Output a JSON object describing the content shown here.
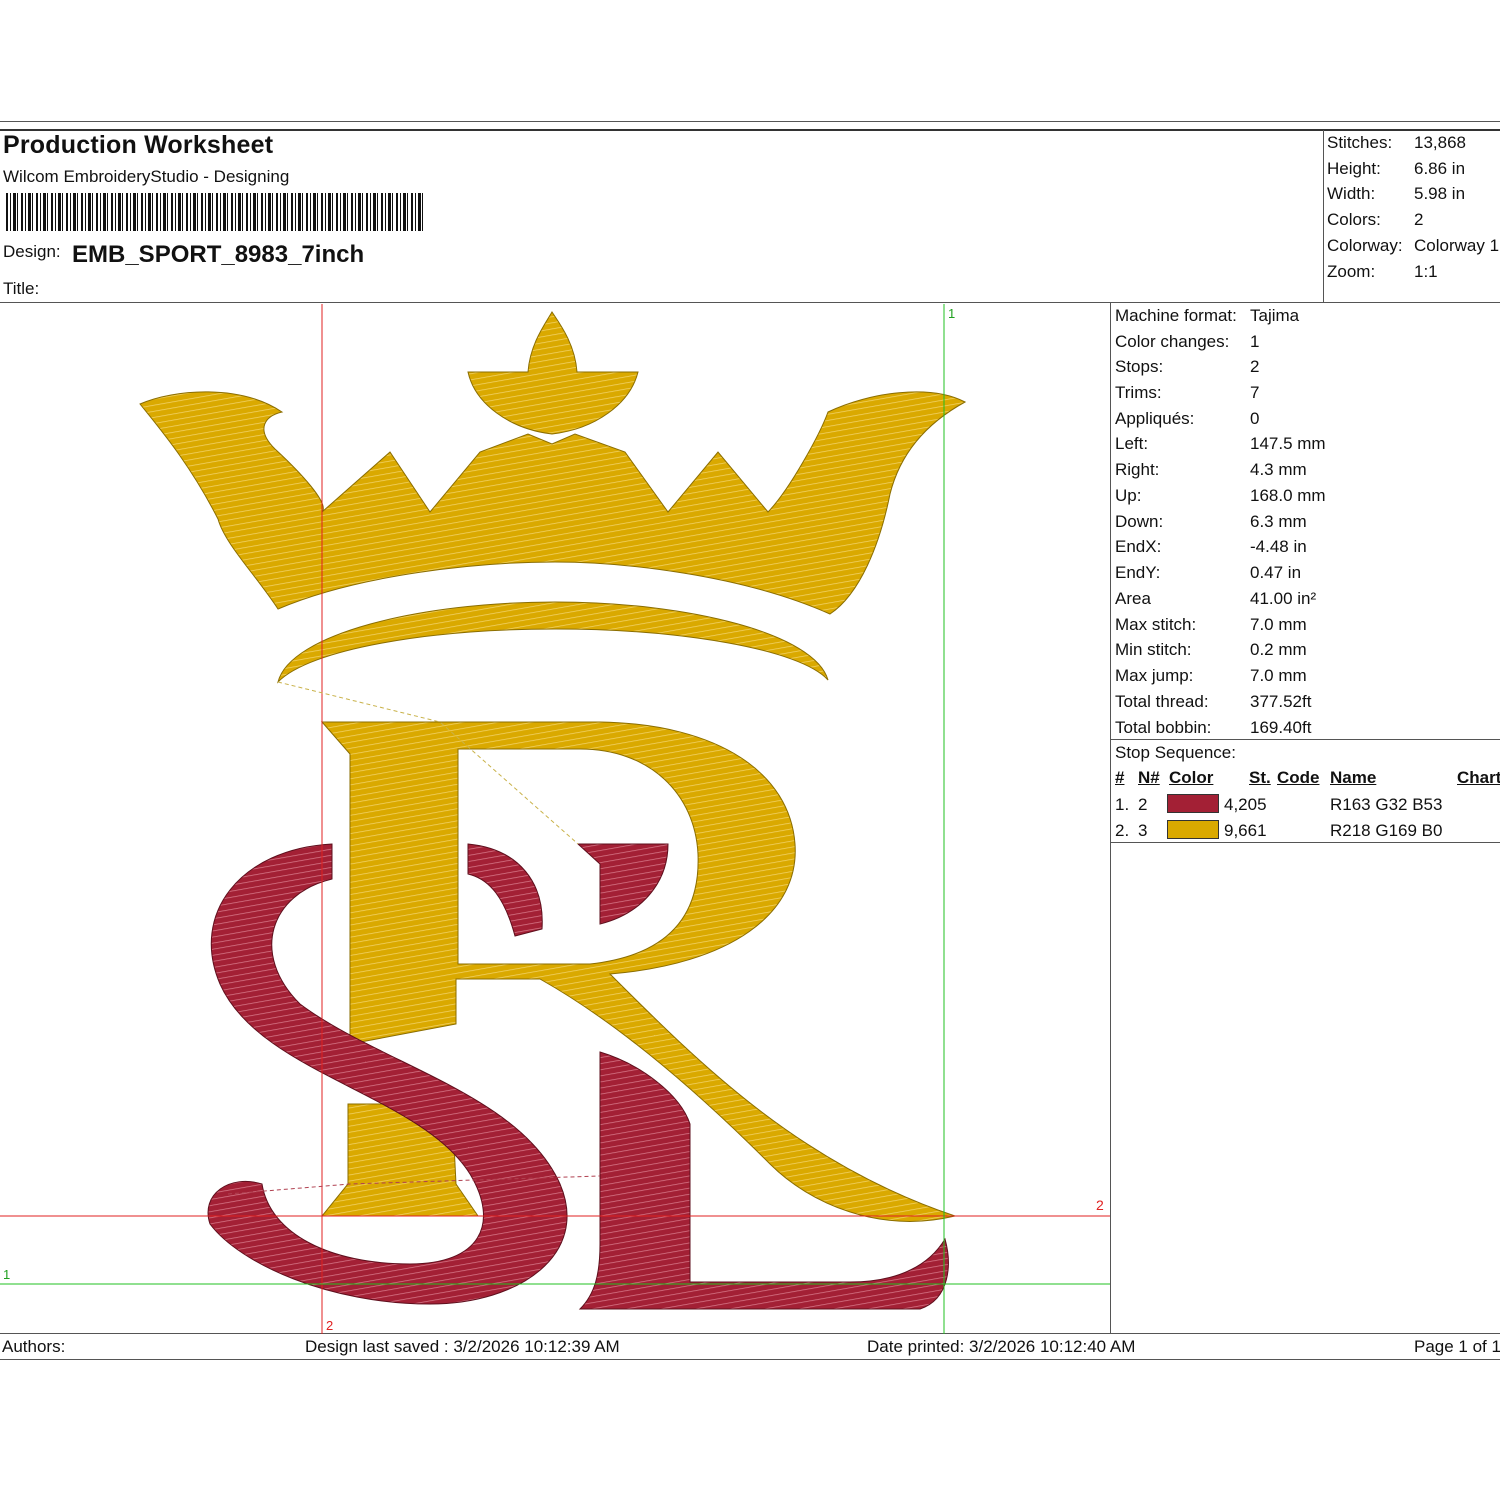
{
  "header": {
    "title": "Production Worksheet",
    "subtitle": "Wilcom EmbroideryStudio - Designing",
    "design_label": "Design:",
    "design_name": "EMB_SPORT_8983_7inch",
    "title_label": "Title:"
  },
  "summary": [
    {
      "label": "Stitches:",
      "value": "13,868"
    },
    {
      "label": "Height:",
      "value": "6.86 in"
    },
    {
      "label": "Width:",
      "value": "5.98 in"
    },
    {
      "label": "Colors:",
      "value": "2"
    },
    {
      "label": "Colorway:",
      "value": "Colorway 1"
    },
    {
      "label": "Zoom:",
      "value": "1:1"
    }
  ],
  "machine_info": [
    {
      "label": "Machine format:",
      "value": "Tajima"
    },
    {
      "label": "Color changes:",
      "value": "1"
    },
    {
      "label": "Stops:",
      "value": "2"
    },
    {
      "label": "Trims:",
      "value": "7"
    },
    {
      "label": "Appliqués:",
      "value": "0"
    },
    {
      "label": "Left:",
      "value": "147.5 mm"
    },
    {
      "label": "Right:",
      "value": "4.3 mm"
    },
    {
      "label": "Up:",
      "value": "168.0 mm"
    },
    {
      "label": "Down:",
      "value": "6.3 mm"
    },
    {
      "label": "EndX:",
      "value": "-4.48 in"
    },
    {
      "label": "EndY:",
      "value": "0.47 in"
    },
    {
      "label": "Area",
      "value": " 41.00 in²"
    },
    {
      "label": "Max stitch:",
      "value": "7.0 mm"
    },
    {
      "label": "Min stitch:",
      "value": "0.2 mm"
    },
    {
      "label": "Max jump:",
      "value": "7.0 mm"
    },
    {
      "label": "Total thread:",
      "value": "377.52ft"
    },
    {
      "label": "Total bobbin:",
      "value": "169.40ft"
    }
  ],
  "stop_sequence": {
    "title": "Stop Sequence:",
    "columns": [
      "#",
      "N#",
      "Color",
      "St.",
      "Code",
      "Name",
      "Chart"
    ],
    "rows": [
      {
        "index": "1.",
        "n": "2",
        "color": "#A32035",
        "stitches": "4,205",
        "name": "R163 G32 B53"
      },
      {
        "index": "2.",
        "n": "3",
        "color": "#DAA900",
        "stitches": "9,661",
        "name": "R218 G169 B0"
      }
    ]
  },
  "canvas_markers": {
    "top_green": "1",
    "right_red": "2",
    "left_green": "1",
    "bottom_red": "2"
  },
  "footer": {
    "authors": "Authors:",
    "saved": "Design last saved : 3/2/2026 10:12:39 AM",
    "printed": "Date printed: 3/2/2026 10:12:40 AM",
    "page": "Page 1 of 1"
  }
}
